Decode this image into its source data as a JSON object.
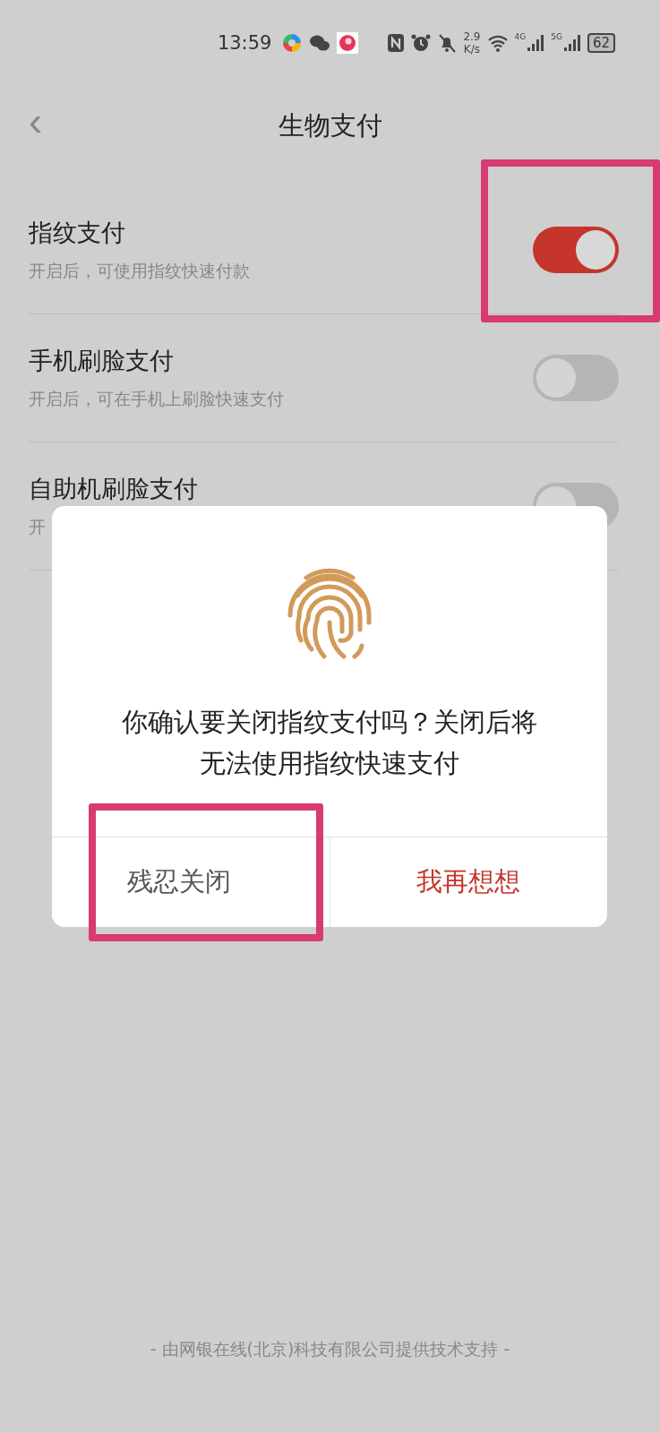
{
  "status_bar": {
    "time": "13:59",
    "net_speed": "2.9",
    "net_unit": "K/s",
    "sim1": "4G",
    "sim2": "5G",
    "battery": "62"
  },
  "header": {
    "back": "‹",
    "title": "生物支付"
  },
  "settings": [
    {
      "title": "指纹支付",
      "subtitle": "开启后，可使用指纹快速付款",
      "on": true,
      "highlighted": true
    },
    {
      "title": "手机刷脸支付",
      "subtitle": "开启后，可在手机上刷脸快速支付",
      "on": false,
      "highlighted": false
    },
    {
      "title": "自助机刷脸支付",
      "subtitle": "开",
      "on": false,
      "highlighted": false
    }
  ],
  "dialog": {
    "message": "你确认要关闭指纹支付吗？关闭后将无法使用指纹快速支付",
    "buttons": [
      {
        "label": "残忍关闭",
        "kind": "normal",
        "highlighted": true
      },
      {
        "label": "我再想想",
        "kind": "primary",
        "highlighted": false
      }
    ]
  },
  "footer": "- 由网银在线(北京)科技有限公司提供技术支持 -"
}
